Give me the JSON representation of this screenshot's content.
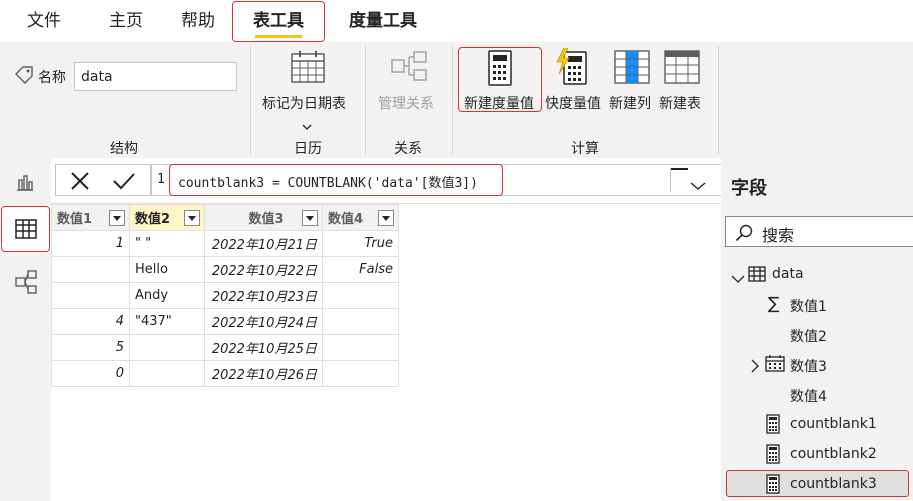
{
  "tabs": [
    "文件",
    "主页",
    "帮助",
    "表工具",
    "度量工具"
  ],
  "ribbon": {
    "name_label": "名称",
    "name_value": "data",
    "groups": {
      "structure": "结构",
      "calendar": "日历",
      "relations": "关系",
      "calc": "计算"
    },
    "buttons": {
      "mark_date": "标记为日期表",
      "manage_rel": "管理关系",
      "new_measure": "新建度量值",
      "quick_measure": "快度量值",
      "new_column": "新建列",
      "new_table": "新建表"
    }
  },
  "formula": {
    "line": "1",
    "text": "countblank3 = COUNTBLANK('data'[数值3])"
  },
  "table": {
    "headers": [
      "数值1",
      "数值2",
      "数值3",
      "数值4"
    ],
    "rows": [
      [
        "1",
        "\" \"",
        "2022年10月21日",
        "True"
      ],
      [
        "",
        "Hello",
        "2022年10月22日",
        "False"
      ],
      [
        "",
        "Andy",
        "2022年10月23日",
        ""
      ],
      [
        "4",
        "\"437\"",
        "2022年10月24日",
        ""
      ],
      [
        "5",
        "",
        "2022年10月25日",
        ""
      ],
      [
        "0",
        "",
        "2022年10月26日",
        ""
      ]
    ]
  },
  "fields": {
    "title": "字段",
    "search_placeholder": "搜索",
    "table_name": "data",
    "items": [
      "数值1",
      "数值2",
      "数值3",
      "数值4",
      "countblank1",
      "countblank2",
      "countblank3"
    ]
  },
  "colors": {
    "accent": "#f2c811",
    "highlight": "#d13438"
  }
}
